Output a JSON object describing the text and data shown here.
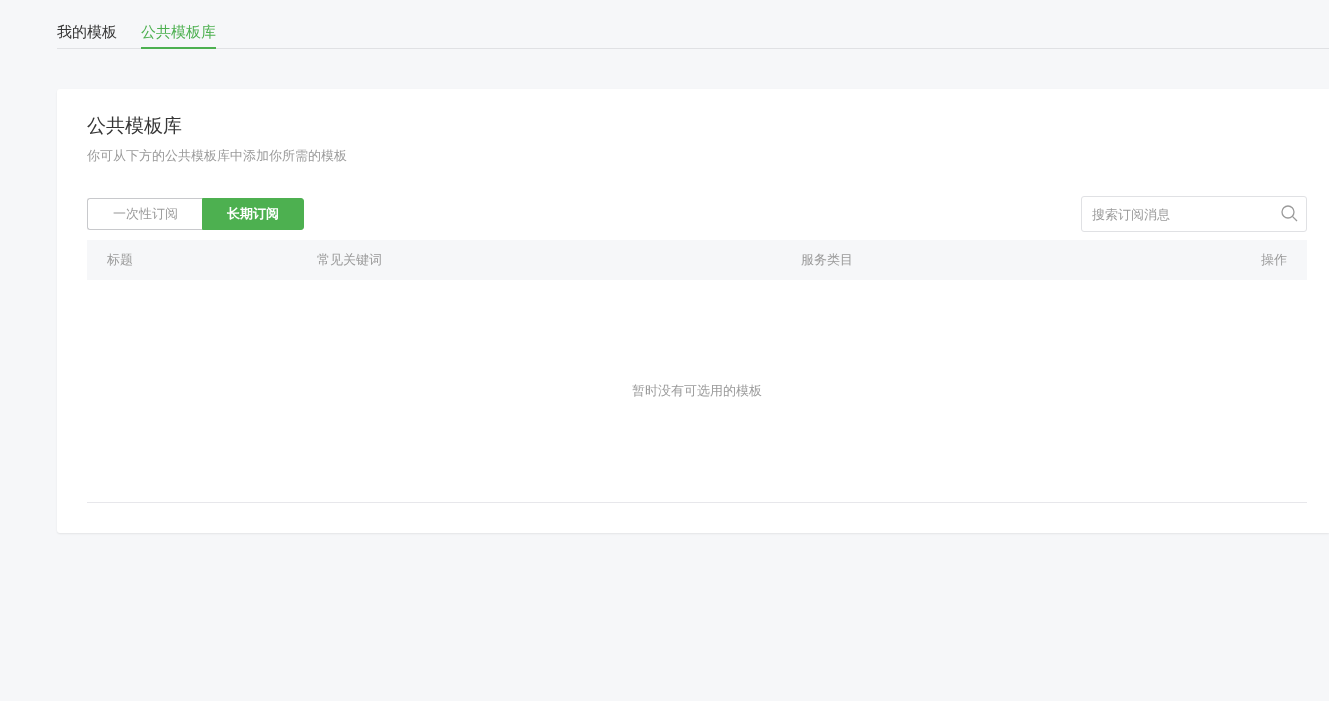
{
  "tabs": [
    {
      "label": "我的模板",
      "selected": false
    },
    {
      "label": "公共模板库",
      "selected": true
    }
  ],
  "panel": {
    "title": "公共模板库",
    "subtitle": "你可从下方的公共模板库中添加你所需的模板",
    "segments": [
      {
        "label": "一次性订阅",
        "selected": false
      },
      {
        "label": "长期订阅",
        "selected": true
      }
    ],
    "search": {
      "placeholder": "搜索订阅消息"
    },
    "table": {
      "columns": [
        "标题",
        "常见关键词",
        "服务类目",
        "操作"
      ],
      "empty_text": "暂时没有可选用的模板"
    }
  }
}
